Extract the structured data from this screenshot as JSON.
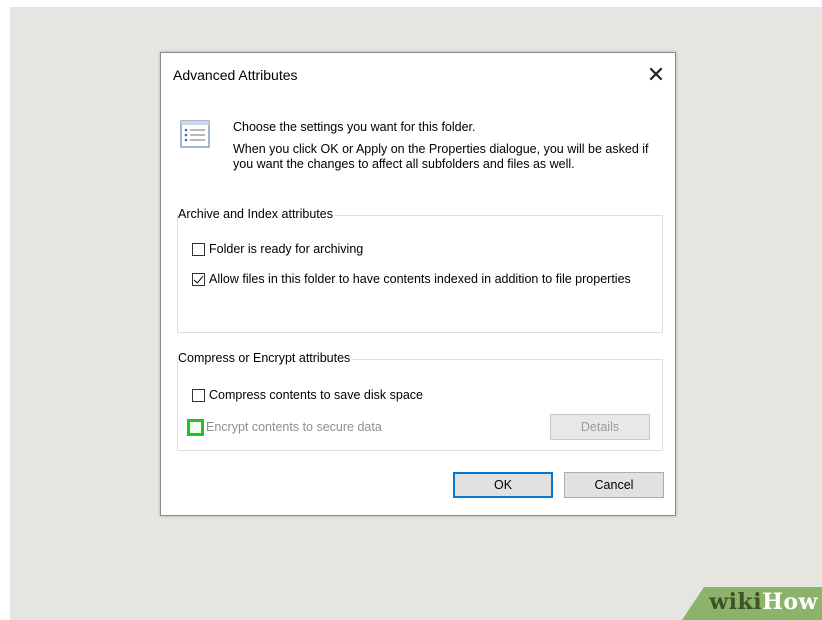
{
  "dialog": {
    "title": "Advanced Attributes",
    "close_glyph": "✕",
    "info_icon": "folder-attributes-icon",
    "info_line1": "Choose the settings you want for this folder.",
    "info_line2": "When you click OK or Apply on the Properties dialogue, you will be asked if you want the changes to affect all subfolders and files as well."
  },
  "archive_group": {
    "legend": "Archive and Index attributes",
    "items": [
      {
        "label": "Folder is ready for archiving",
        "checked": false
      },
      {
        "label": "Allow files in this folder to have contents indexed in addition to file properties",
        "checked": true
      }
    ]
  },
  "compress_group": {
    "legend": "Compress or Encrypt attributes",
    "items": [
      {
        "label": "Compress contents to save disk space",
        "checked": false
      },
      {
        "label": "Encrypt contents to secure data",
        "checked": false,
        "disabled": true,
        "highlighted": true
      }
    ],
    "details_label": "Details"
  },
  "buttons": {
    "ok_label": "OK",
    "cancel_label": "Cancel"
  },
  "watermark": {
    "wiki": "wiki",
    "how": "How"
  },
  "colors": {
    "highlight": "#22c12b",
    "default_button_border": "#0078d7",
    "watermark_bar": "#8cb36a"
  }
}
